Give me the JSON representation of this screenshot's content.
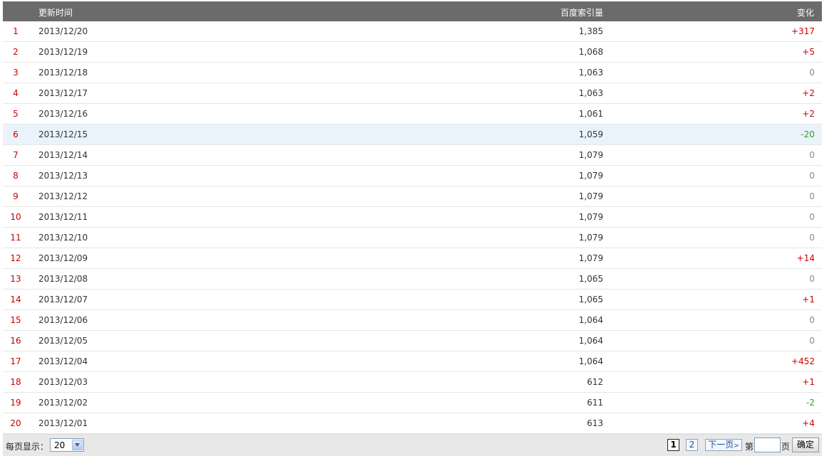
{
  "table": {
    "headers": {
      "date": "更新时间",
      "index": "百度索引量",
      "change": "变化"
    },
    "rows": [
      {
        "num": "1",
        "date": "2013/12/20",
        "index": "1,385",
        "change": "+317",
        "dir": "pos"
      },
      {
        "num": "2",
        "date": "2013/12/19",
        "index": "1,068",
        "change": "+5",
        "dir": "pos"
      },
      {
        "num": "3",
        "date": "2013/12/18",
        "index": "1,063",
        "change": "0",
        "dir": "zero"
      },
      {
        "num": "4",
        "date": "2013/12/17",
        "index": "1,063",
        "change": "+2",
        "dir": "pos"
      },
      {
        "num": "5",
        "date": "2013/12/16",
        "index": "1,061",
        "change": "+2",
        "dir": "pos"
      },
      {
        "num": "6",
        "date": "2013/12/15",
        "index": "1,059",
        "change": "-20",
        "dir": "neg",
        "highlighted": true
      },
      {
        "num": "7",
        "date": "2013/12/14",
        "index": "1,079",
        "change": "0",
        "dir": "zero"
      },
      {
        "num": "8",
        "date": "2013/12/13",
        "index": "1,079",
        "change": "0",
        "dir": "zero"
      },
      {
        "num": "9",
        "date": "2013/12/12",
        "index": "1,079",
        "change": "0",
        "dir": "zero"
      },
      {
        "num": "10",
        "date": "2013/12/11",
        "index": "1,079",
        "change": "0",
        "dir": "zero"
      },
      {
        "num": "11",
        "date": "2013/12/10",
        "index": "1,079",
        "change": "0",
        "dir": "zero"
      },
      {
        "num": "12",
        "date": "2013/12/09",
        "index": "1,079",
        "change": "+14",
        "dir": "pos"
      },
      {
        "num": "13",
        "date": "2013/12/08",
        "index": "1,065",
        "change": "0",
        "dir": "zero"
      },
      {
        "num": "14",
        "date": "2013/12/07",
        "index": "1,065",
        "change": "+1",
        "dir": "pos"
      },
      {
        "num": "15",
        "date": "2013/12/06",
        "index": "1,064",
        "change": "0",
        "dir": "zero"
      },
      {
        "num": "16",
        "date": "2013/12/05",
        "index": "1,064",
        "change": "0",
        "dir": "zero"
      },
      {
        "num": "17",
        "date": "2013/12/04",
        "index": "1,064",
        "change": "+452",
        "dir": "pos"
      },
      {
        "num": "18",
        "date": "2013/12/03",
        "index": "612",
        "change": "+1",
        "dir": "pos"
      },
      {
        "num": "19",
        "date": "2013/12/02",
        "index": "611",
        "change": "-2",
        "dir": "neg"
      },
      {
        "num": "20",
        "date": "2013/12/01",
        "index": "613",
        "change": "+4",
        "dir": "pos"
      }
    ]
  },
  "footer": {
    "per_page_label": "每页显示：",
    "per_page_value": "20",
    "current_page": "1",
    "page_2": "2",
    "next_label": "下一页",
    "next_icon": "chevron-right-icon",
    "page_prefix": "第",
    "page_suffix": "页",
    "go_button": "确定"
  },
  "colors": {
    "positive": "#cc0000",
    "negative": "#339933",
    "zero": "#888888",
    "header_bg": "#6b6b6b"
  }
}
